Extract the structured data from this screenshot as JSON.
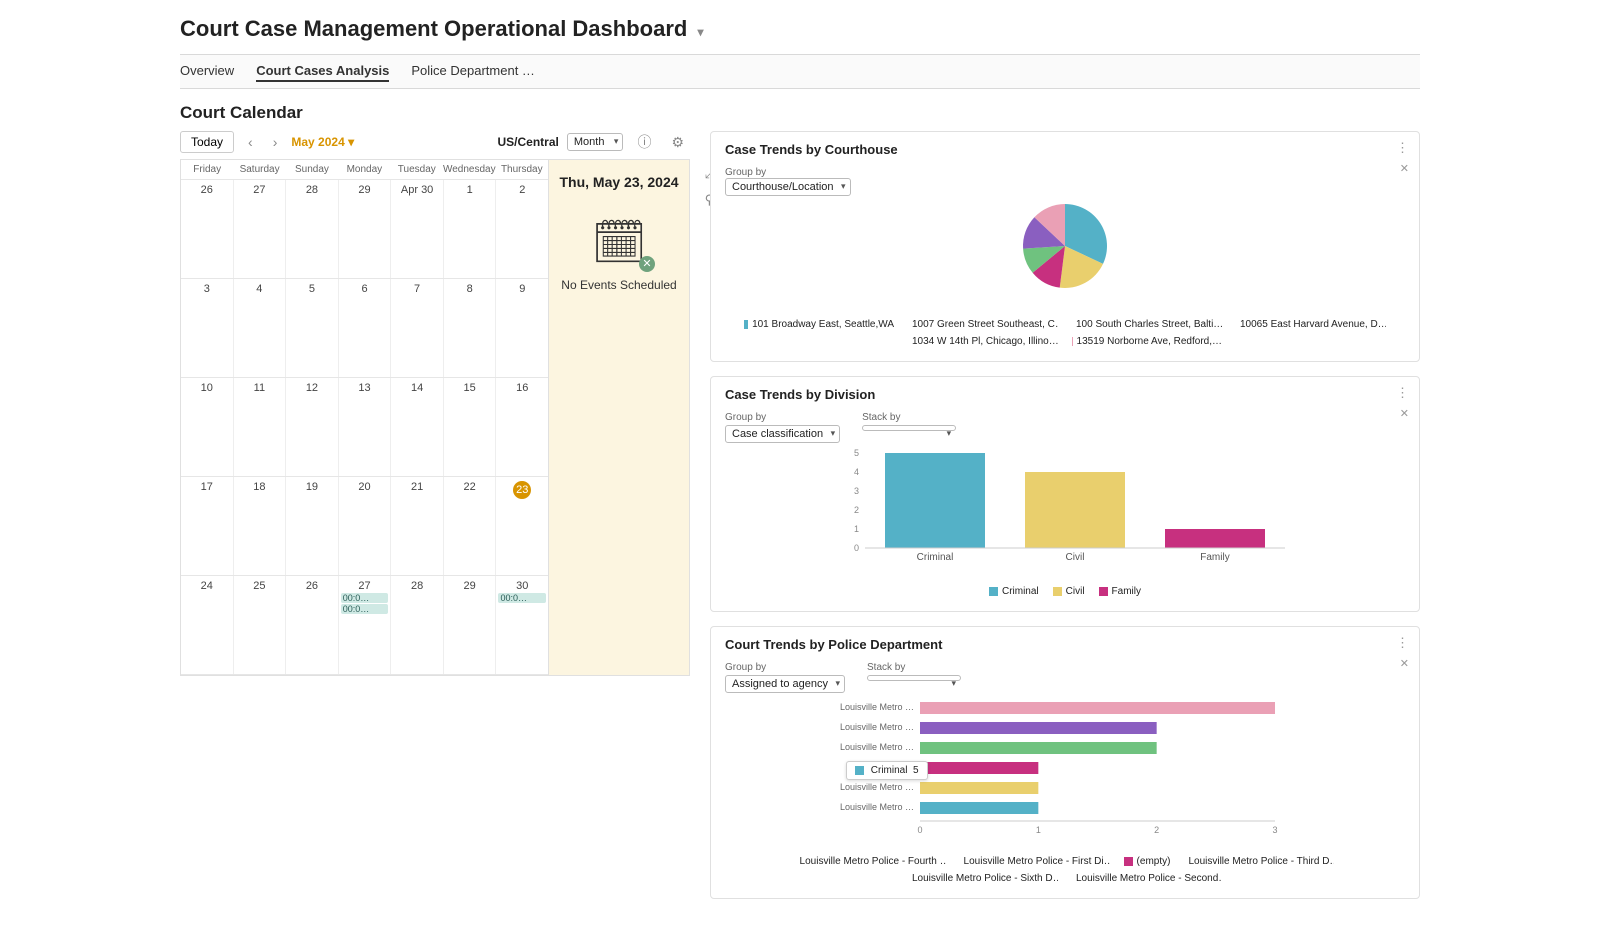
{
  "header": {
    "title": "Court Case Management Operational Dashboard"
  },
  "tabs": [
    {
      "label": "Overview",
      "active": false
    },
    {
      "label": "Court Cases Analysis",
      "active": true
    },
    {
      "label": "Police Department …",
      "active": false
    }
  ],
  "calendar": {
    "section_title": "Court Calendar",
    "today_button": "Today",
    "month_label": "May 2024",
    "timezone": "US/Central",
    "view_select": "Month",
    "dow": [
      "Friday",
      "Saturday",
      "Sunday",
      "Monday",
      "Tuesday",
      "Wednesday",
      "Thursday"
    ],
    "weeks": [
      [
        {
          "n": "26"
        },
        {
          "n": "27"
        },
        {
          "n": "28"
        },
        {
          "n": "29"
        },
        {
          "n": "Apr 30"
        },
        {
          "n": "1"
        },
        {
          "n": "2"
        }
      ],
      [
        {
          "n": "3"
        },
        {
          "n": "4"
        },
        {
          "n": "5"
        },
        {
          "n": "6"
        },
        {
          "n": "7"
        },
        {
          "n": "8"
        },
        {
          "n": "9"
        }
      ],
      [
        {
          "n": "10"
        },
        {
          "n": "11"
        },
        {
          "n": "12"
        },
        {
          "n": "13"
        },
        {
          "n": "14"
        },
        {
          "n": "15"
        },
        {
          "n": "16"
        }
      ],
      [
        {
          "n": "17"
        },
        {
          "n": "18"
        },
        {
          "n": "19"
        },
        {
          "n": "20"
        },
        {
          "n": "21"
        },
        {
          "n": "22"
        },
        {
          "n": "23",
          "today": true
        }
      ],
      [
        {
          "n": "24"
        },
        {
          "n": "25"
        },
        {
          "n": "26"
        },
        {
          "n": "27",
          "evts": [
            "00:0…",
            "00:0…"
          ]
        },
        {
          "n": "28"
        },
        {
          "n": "29"
        },
        {
          "n": "30",
          "evts": [
            "00:0…"
          ]
        }
      ]
    ],
    "day_panel": {
      "title": "Thu, May 23, 2024",
      "empty_text": "No Events Scheduled"
    }
  },
  "colors": {
    "teal": "#54b1c7",
    "yellow": "#e9cf6d",
    "magenta": "#c7307f",
    "green": "#6fc27f",
    "purple": "#8a5fc0",
    "pink": "#eaa0b5",
    "blue": "#4f9fcf"
  },
  "cards": {
    "courthouse": {
      "title": "Case Trends by Courthouse",
      "group_by_label": "Group by",
      "group_by_value": "Courthouse/Location"
    },
    "division": {
      "title": "Case Trends by Division",
      "group_by_label": "Group by",
      "group_by_value": "Case classification",
      "stack_by_label": "Stack by",
      "stack_by_value": ""
    },
    "police": {
      "title": "Court Trends by Police Department",
      "group_by_label": "Group by",
      "group_by_value": "Assigned to agency",
      "stack_by_label": "Stack by",
      "stack_by_value": "",
      "tooltip_label": "Criminal",
      "tooltip_value": "5"
    }
  },
  "chart_data": [
    {
      "id": "courthouse",
      "type": "pie",
      "title": "Case Trends by Courthouse",
      "series": [
        {
          "name": "101 Broadway East, Seattle,WA",
          "value": 32,
          "color": "teal"
        },
        {
          "name": "1007 Green Street Southeast, C…",
          "value": 20,
          "color": "yellow"
        },
        {
          "name": "100 South Charles Street, Balti…",
          "value": 12,
          "color": "magenta"
        },
        {
          "name": "10065 East Harvard Avenue, D…",
          "value": 10,
          "color": "green"
        },
        {
          "name": "1034 W 14th Pl, Chicago, Illino…",
          "value": 13,
          "color": "purple"
        },
        {
          "name": "13519 Norborne Ave, Redford,…",
          "value": 13,
          "color": "pink"
        }
      ]
    },
    {
      "id": "division",
      "type": "bar",
      "title": "Case Trends by Division",
      "categories": [
        "Criminal",
        "Civil",
        "Family"
      ],
      "values": [
        5,
        4,
        1
      ],
      "ylim": [
        0,
        5
      ],
      "colors": [
        "teal",
        "yellow",
        "magenta"
      ],
      "legend": [
        {
          "name": "Criminal",
          "color": "teal"
        },
        {
          "name": "Civil",
          "color": "yellow"
        },
        {
          "name": "Family",
          "color": "magenta"
        }
      ]
    },
    {
      "id": "police",
      "type": "bar-h",
      "title": "Court Trends by Police Department",
      "xlim": [
        0,
        3
      ],
      "xticks": [
        0,
        1,
        2,
        3
      ],
      "rows": [
        {
          "label": "Louisville Metro …",
          "value": 3.0,
          "color": "pink"
        },
        {
          "label": "Louisville Metro …",
          "value": 2.0,
          "color": "purple"
        },
        {
          "label": "Louisville Metro …",
          "value": 2.0,
          "color": "green"
        },
        {
          "label": "(empty)",
          "value": 1.0,
          "color": "magenta"
        },
        {
          "label": "Louisville Metro …",
          "value": 1.0,
          "color": "yellow"
        },
        {
          "label": "Louisville Metro …",
          "value": 1.0,
          "color": "teal"
        }
      ],
      "legend": [
        {
          "name": "Louisville Metro Police - Fourth …",
          "color": "teal"
        },
        {
          "name": "Louisville Metro Police - First Di…",
          "color": "yellow"
        },
        {
          "name": "(empty)",
          "color": "magenta"
        },
        {
          "name": "Louisville Metro Police - Third D…",
          "color": "green"
        },
        {
          "name": "Louisville Metro Police - Sixth D…",
          "color": "purple"
        },
        {
          "name": "Louisville Metro Police - Second…",
          "color": "pink"
        }
      ]
    }
  ]
}
